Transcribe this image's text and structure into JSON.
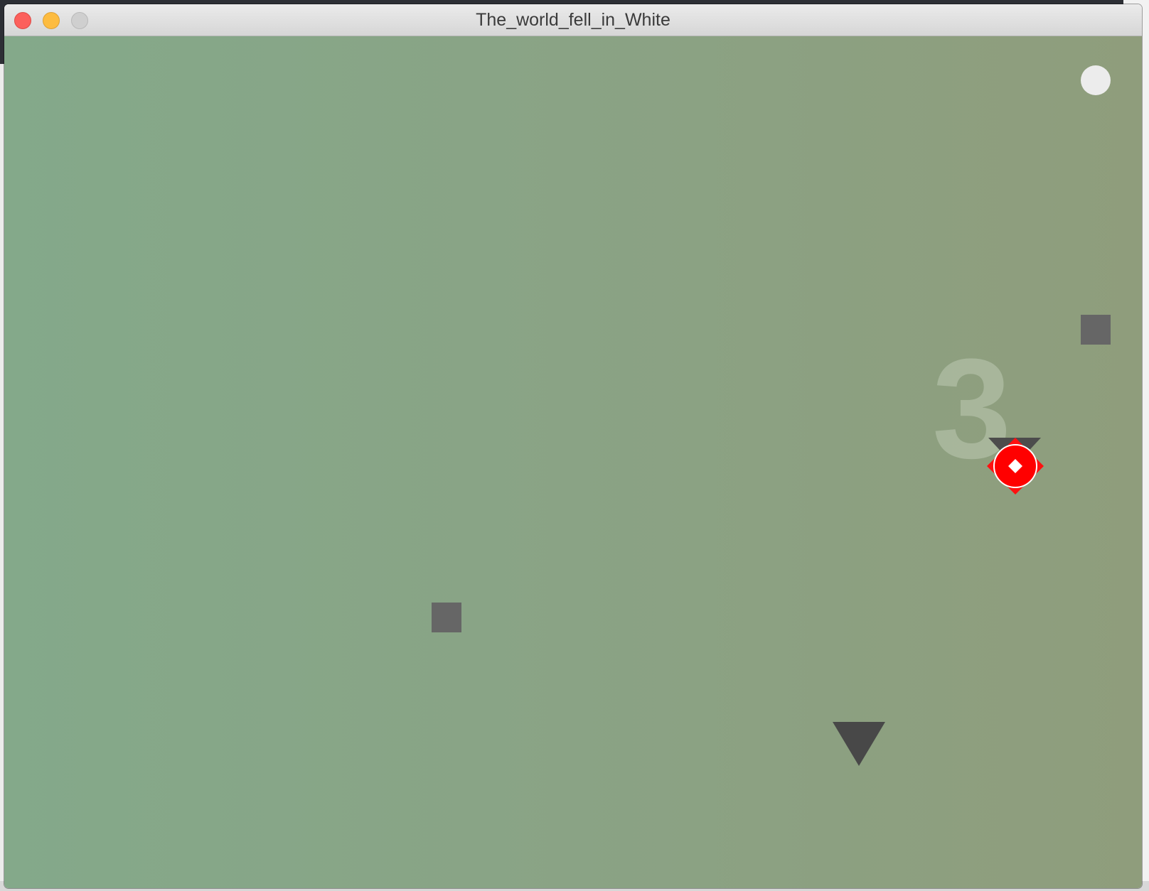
{
  "window": {
    "title": "The_world_fell_in_White"
  },
  "game": {
    "counter": "3",
    "colors": {
      "background_left": "#84a98a",
      "background_right": "#8f9d7c",
      "player": "#ff0000",
      "block": "#666666",
      "spike": "#484848",
      "orb": "#ececec"
    }
  }
}
